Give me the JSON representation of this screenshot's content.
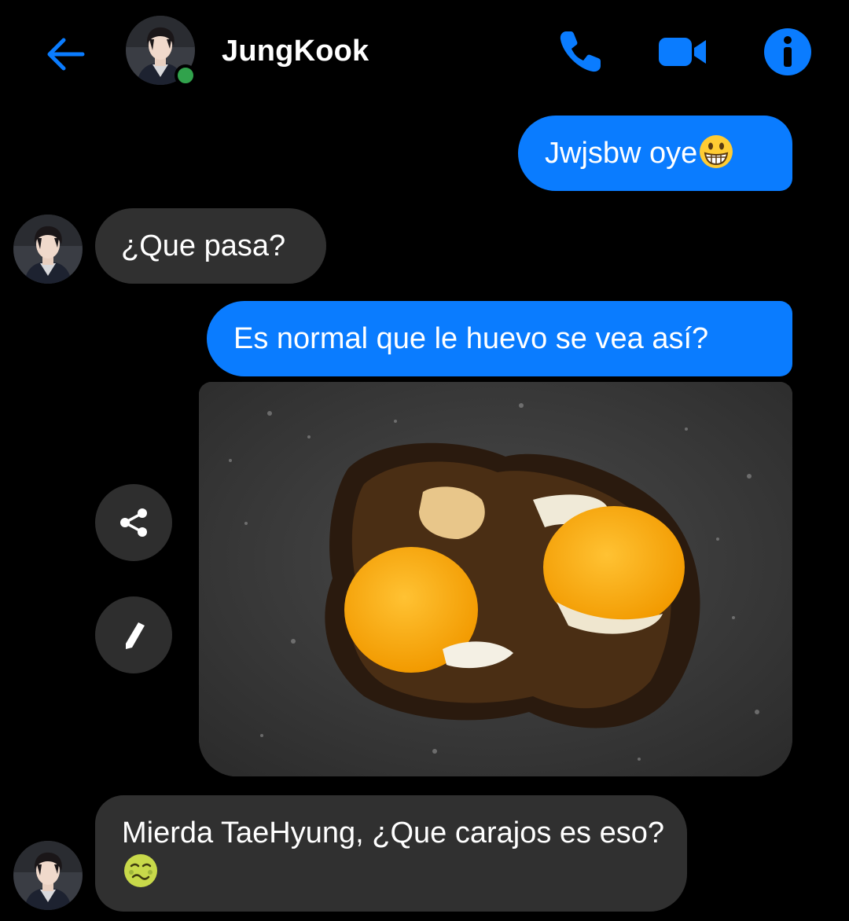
{
  "header": {
    "contact_name": "JungKook",
    "status": "online",
    "icons": [
      "back-arrow-icon",
      "phone-icon",
      "video-camera-icon",
      "info-icon"
    ]
  },
  "messages": [
    {
      "direction": "outgoing",
      "type": "text",
      "text": "Jwjsbw oye",
      "emoji": "grinning-face-with-big-eyes-icon"
    },
    {
      "direction": "incoming",
      "type": "text",
      "text": "¿Que pasa?"
    },
    {
      "direction": "outgoing",
      "type": "text",
      "text": "Es normal que le huevo se vea así?"
    },
    {
      "direction": "outgoing",
      "type": "image",
      "image_description": "burnt fried eggs in a pan"
    },
    {
      "direction": "incoming",
      "type": "text",
      "text": "Mierda TaeHyung, ¿Que carajos es eso?",
      "emoji": "nauseated-face-icon"
    }
  ],
  "image_actions": [
    "share-icon",
    "edit-pencil-icon"
  ],
  "colors": {
    "accent": "#0a7cff",
    "incoming_bubble": "#303030",
    "background": "#000000",
    "online": "#31a24c"
  }
}
